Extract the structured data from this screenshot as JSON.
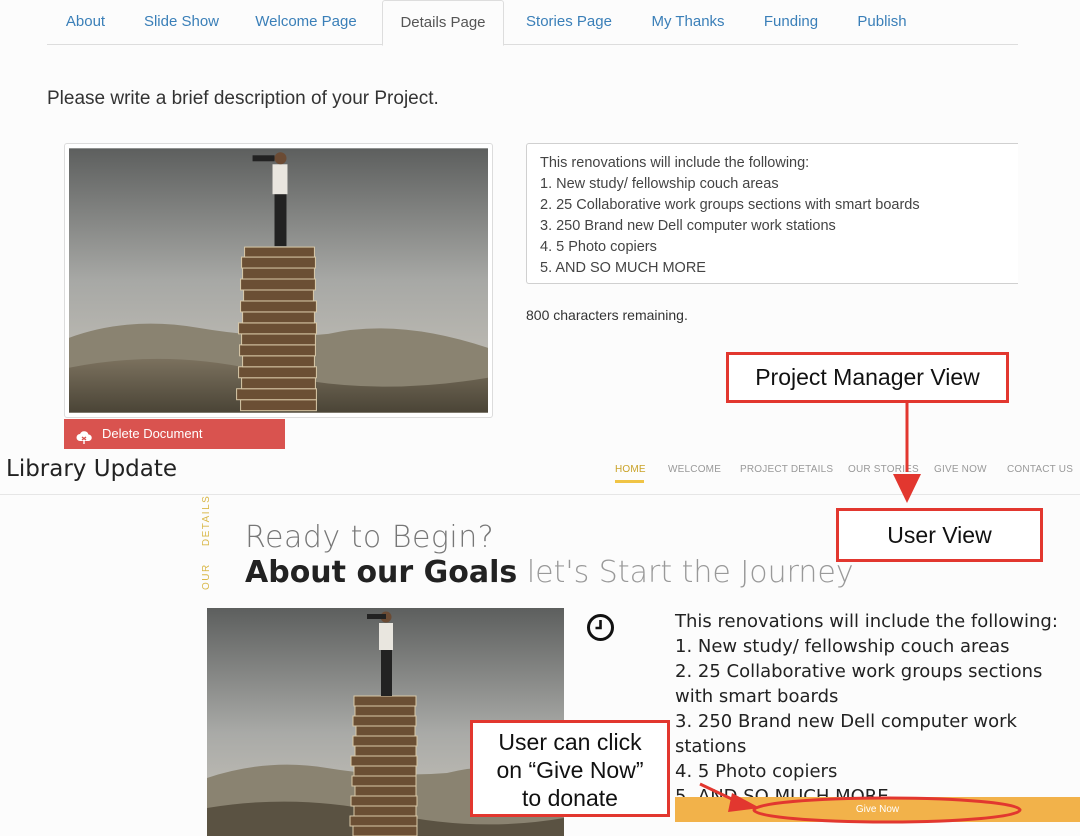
{
  "tabs": [
    {
      "label": "About"
    },
    {
      "label": "Slide Show"
    },
    {
      "label": "Welcome Page"
    },
    {
      "label": "Details Page"
    },
    {
      "label": "Stories Page"
    },
    {
      "label": "My Thanks"
    },
    {
      "label": "Funding"
    },
    {
      "label": "Publish"
    }
  ],
  "active_tab": "Details Page",
  "editor": {
    "prompt": "Please write a brief description of your Project.",
    "description_lines": [
      "This renovations will include the following:",
      "1. New study/ fellowship couch areas",
      "2. 25 Collaborative work groups sections with smart boards",
      "3. 250 Brand new Dell computer work stations",
      "4. 5 Photo copiers",
      "5. AND SO MUCH MORE"
    ],
    "chars_remaining": "800 characters remaining.",
    "delete_label": "Delete Document"
  },
  "annotations": {
    "pm_view": "Project Manager View",
    "user_view": "User View",
    "give_now_note_lines": [
      "User can click",
      "on “Give Now”",
      "to donate"
    ]
  },
  "site": {
    "title": "Library Update",
    "nav": [
      "HOME",
      "WELCOME",
      "PROJECT DETAILS",
      "OUR STORIES",
      "GIVE NOW",
      "CONTACT US"
    ],
    "section_label_part1": "OUR",
    "section_label_part2": "DETAILS",
    "heading_line1": "Ready to Begin?",
    "heading_bold": "About our Goals",
    "heading_thin": "let's Start the Journey",
    "description_lines": [
      "This renovations will include the following:",
      "1. New study/ fellowship couch areas",
      "2. 25 Collaborative work groups sections with smart boards",
      "3. 250 Brand new Dell computer work stations",
      "4. 5 Photo copiers",
      "5. AND SO MUCH MORE"
    ],
    "give_now_label": "Give Now"
  },
  "colors": {
    "tab_link": "#3a7fb8",
    "delete_red": "#d9534f",
    "annotation_red": "#e2372f",
    "accent_gold": "#f0c445",
    "give_now_orange": "#f2b24a"
  },
  "icons": [
    "cloud-delete-icon",
    "clock-icon",
    "project-photo",
    "arrow-icon"
  ]
}
